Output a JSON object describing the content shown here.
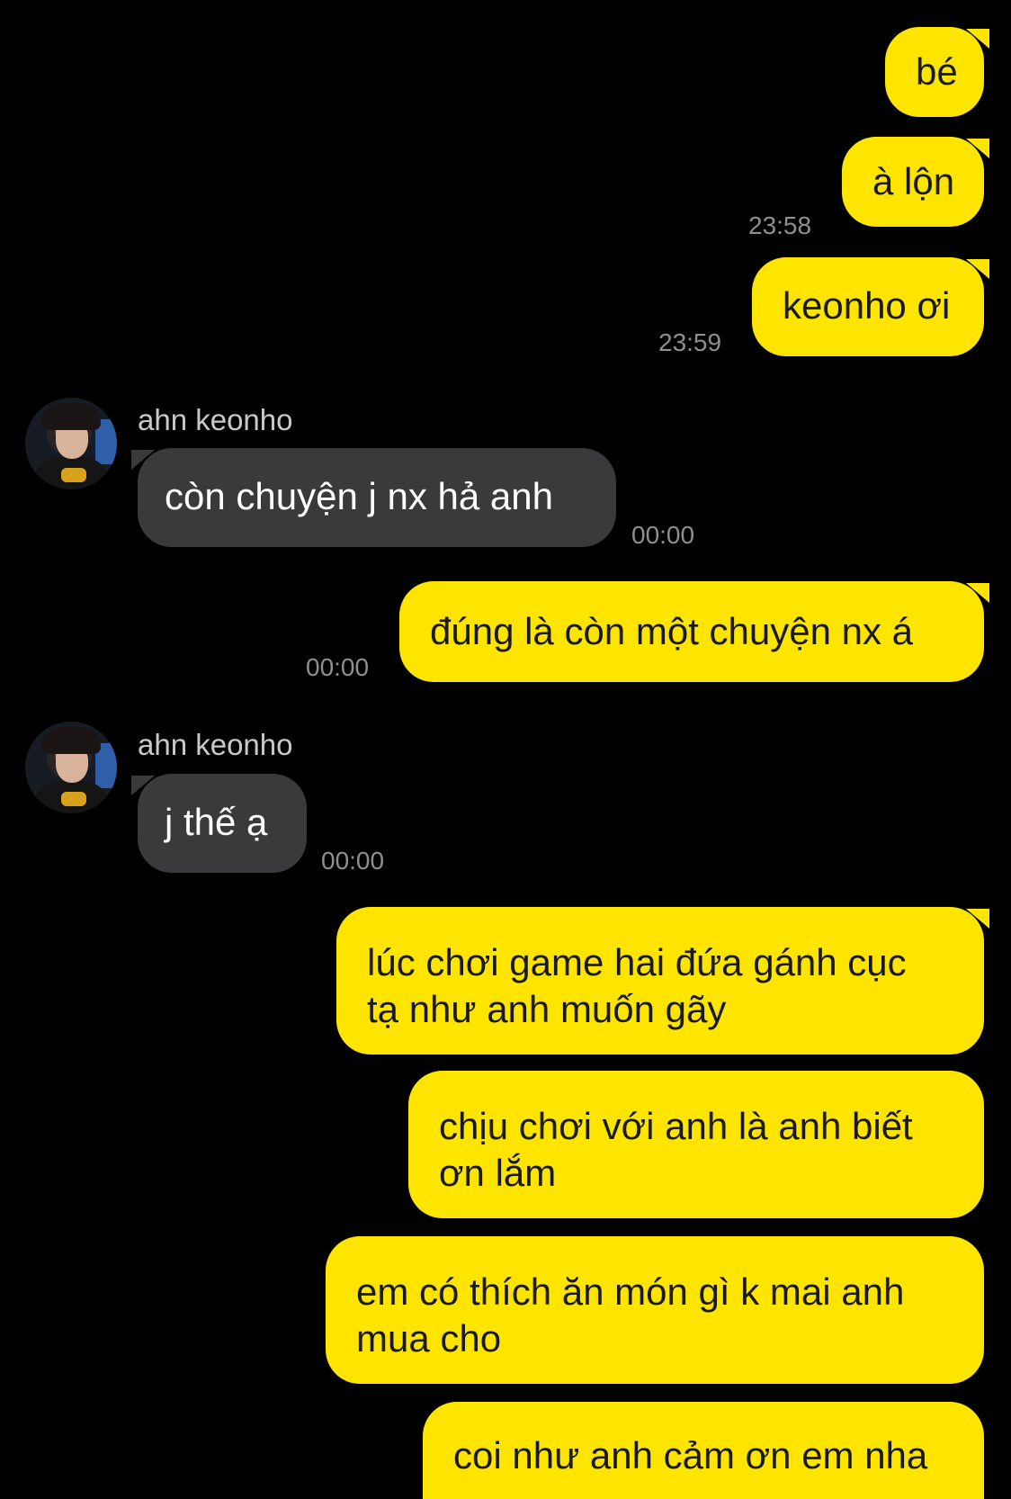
{
  "colors": {
    "background": "#000000",
    "outgoing_bubble": "#FEE500",
    "incoming_bubble": "#3a3a3c",
    "timestamp": "#8e8e93"
  },
  "contact": {
    "name": "ahn keonho"
  },
  "messages": [
    {
      "direction": "out",
      "text": "bé"
    },
    {
      "direction": "out",
      "text": "à lộn",
      "time": "23:58"
    },
    {
      "direction": "out",
      "text": "keonho ơi",
      "time": "23:59"
    },
    {
      "direction": "in",
      "sender": "ahn keonho",
      "text": "còn chuyện j nx hả anh",
      "time": "00:00"
    },
    {
      "direction": "out",
      "text": "đúng là còn một chuyện nx á",
      "time": "00:00"
    },
    {
      "direction": "in",
      "sender": "ahn keonho",
      "text": "j thế ạ",
      "time": "00:00"
    },
    {
      "direction": "out",
      "lines": [
        "lúc chơi game hai đứa gánh cục",
        "tạ như anh muốn gãy"
      ]
    },
    {
      "direction": "out",
      "lines": [
        "chịu chơi với anh là anh biết",
        "ơn lắm"
      ]
    },
    {
      "direction": "out",
      "lines": [
        "em có thích ăn món gì k mai anh",
        "mua cho"
      ]
    },
    {
      "direction": "out",
      "text": "coi như anh cảm ơn em nha"
    }
  ]
}
